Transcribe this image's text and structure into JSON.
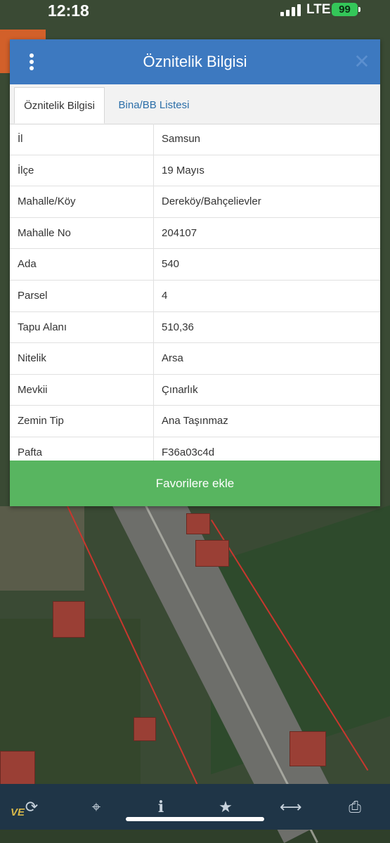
{
  "status_bar": {
    "time": "12:18",
    "network": "LTE",
    "battery": "99"
  },
  "dialog": {
    "title": "Öznitelik Bilgisi",
    "tabs": [
      {
        "label": "Öznitelik Bilgisi",
        "active": true
      },
      {
        "label": "Bina/BB Listesi",
        "active": false
      }
    ],
    "rows": [
      {
        "key": "İl",
        "value": "Samsun"
      },
      {
        "key": "İlçe",
        "value": "19 Mayıs"
      },
      {
        "key": "Mahalle/Köy",
        "value": "Dereköy/Bahçelievler"
      },
      {
        "key": "Mahalle No",
        "value": "204107"
      },
      {
        "key": "Ada",
        "value": "540"
      },
      {
        "key": "Parsel",
        "value": "4"
      },
      {
        "key": "Tapu Alanı",
        "value": "510,36"
      },
      {
        "key": "Nitelik",
        "value": "Arsa"
      },
      {
        "key": "Mevkii",
        "value": "Çınarlık"
      },
      {
        "key": "Zemin Tip",
        "value": "Ana Taşınmaz"
      },
      {
        "key": "Pafta",
        "value": "F36a03c4d"
      }
    ],
    "favorite_button": "Favorilere ekle"
  },
  "toolbar": {
    "logo": "VE",
    "icons": [
      "refresh-icon",
      "crosshair-icon",
      "info-icon",
      "star-icon",
      "measure-icon",
      "print-icon"
    ]
  },
  "colors": {
    "header": "#3d79c0",
    "button": "#58b560",
    "toolbar": "#1f3547"
  }
}
